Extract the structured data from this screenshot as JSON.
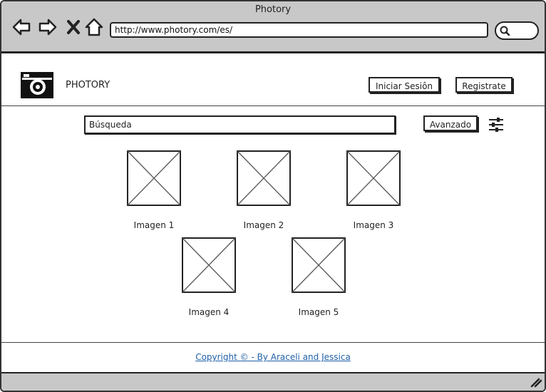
{
  "window": {
    "title": "Photory"
  },
  "browser": {
    "url": "http://www.photory.com/es/",
    "icons": [
      "back-arrow-icon",
      "forward-arrow-icon",
      "close-x-icon",
      "home-icon",
      "search-icon"
    ]
  },
  "header": {
    "brand": "PHOTORY",
    "logo_icon": "camera-icon",
    "login_label": "Iniciar Sesiôn",
    "register_label": "Registrate"
  },
  "search": {
    "placeholder": "Búsqueda",
    "advanced_label": "Avanzado",
    "filter_icon": "sliders-icon"
  },
  "gallery": {
    "images": [
      {
        "label": "Imagen 1"
      },
      {
        "label": "Imagen 2"
      },
      {
        "label": "Imagen 3"
      },
      {
        "label": "Imagen 4"
      },
      {
        "label": "Imagen 5"
      }
    ]
  },
  "footer": {
    "copyright": "Copyright © - By Araceli and Jessica"
  },
  "colors": {
    "chrome": "#c8c8c8",
    "border": "#222222",
    "link": "#1f5fa8"
  }
}
